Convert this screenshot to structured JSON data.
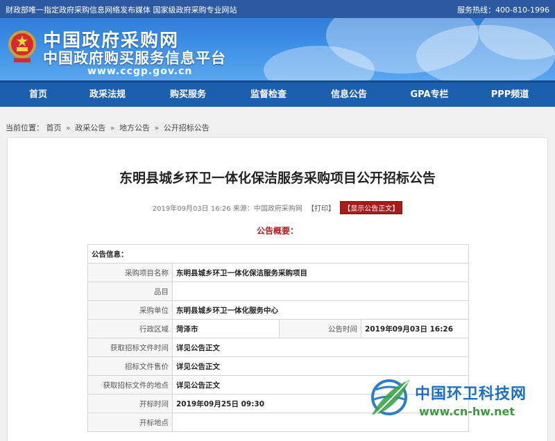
{
  "topbar": {
    "left_text": "财政部唯一指定政府采购信息网络发布媒体 国家级政府采购专业网站",
    "hotline": "服务热线：400-810-1996"
  },
  "banner": {
    "title": "中国政府采购网",
    "subtitle": "中国政府购买服务信息平台",
    "url": "www.ccgp.gov.cn"
  },
  "nav": {
    "items": [
      "首页",
      "政采法规",
      "购买服务",
      "监督检查",
      "信息公告",
      "GPA专栏",
      "PPP频道"
    ]
  },
  "breadcrumb": {
    "prefix": "当前位置：",
    "items": [
      "首页",
      "政采公告",
      "地方公告",
      "公开招标公告"
    ],
    "separator": "»"
  },
  "announcement": {
    "title": "东明县城乡环卫一体化保洁服务采购项目公开招标公告",
    "meta": "2019年09月03日 16:26 来源：中国政府采购网",
    "print_label": "【打印】",
    "show_label": "【显示公告正文】",
    "summary_heading": "公告概要："
  },
  "table": {
    "section_label": "公告信息：",
    "rows": [
      {
        "label": "采购项目名称",
        "value": "东明县城乡环卫一体化保洁服务采购项目"
      },
      {
        "label": "品目",
        "value": ""
      },
      {
        "label": "采购单位",
        "value": "东明县城乡环卫一体化服务中心"
      },
      {
        "label": "行政区域",
        "value": "菏泽市",
        "label2": "公告时间",
        "value2": "2019年09月03日 16:26"
      },
      {
        "label": "获取招标文件时间",
        "value": "详见公告正文"
      },
      {
        "label": "招标文件售价",
        "value": "详见公告正文"
      },
      {
        "label": "获取招标文件的地点",
        "value": "详见公告正文"
      },
      {
        "label": "开标时间",
        "value": "2019年09月25日 09:30"
      },
      {
        "label": "开标地点",
        "value": ""
      }
    ]
  },
  "watermark": {
    "title": "中国环卫科技网",
    "url": "www.cn-hw.net"
  },
  "colors": {
    "topbar": "#2c5aa0",
    "nav": "#1b5fae",
    "accent_red": "#b01c1c",
    "watermark_blue": "#1f6fbf",
    "watermark_green": "#3c9a3c"
  }
}
